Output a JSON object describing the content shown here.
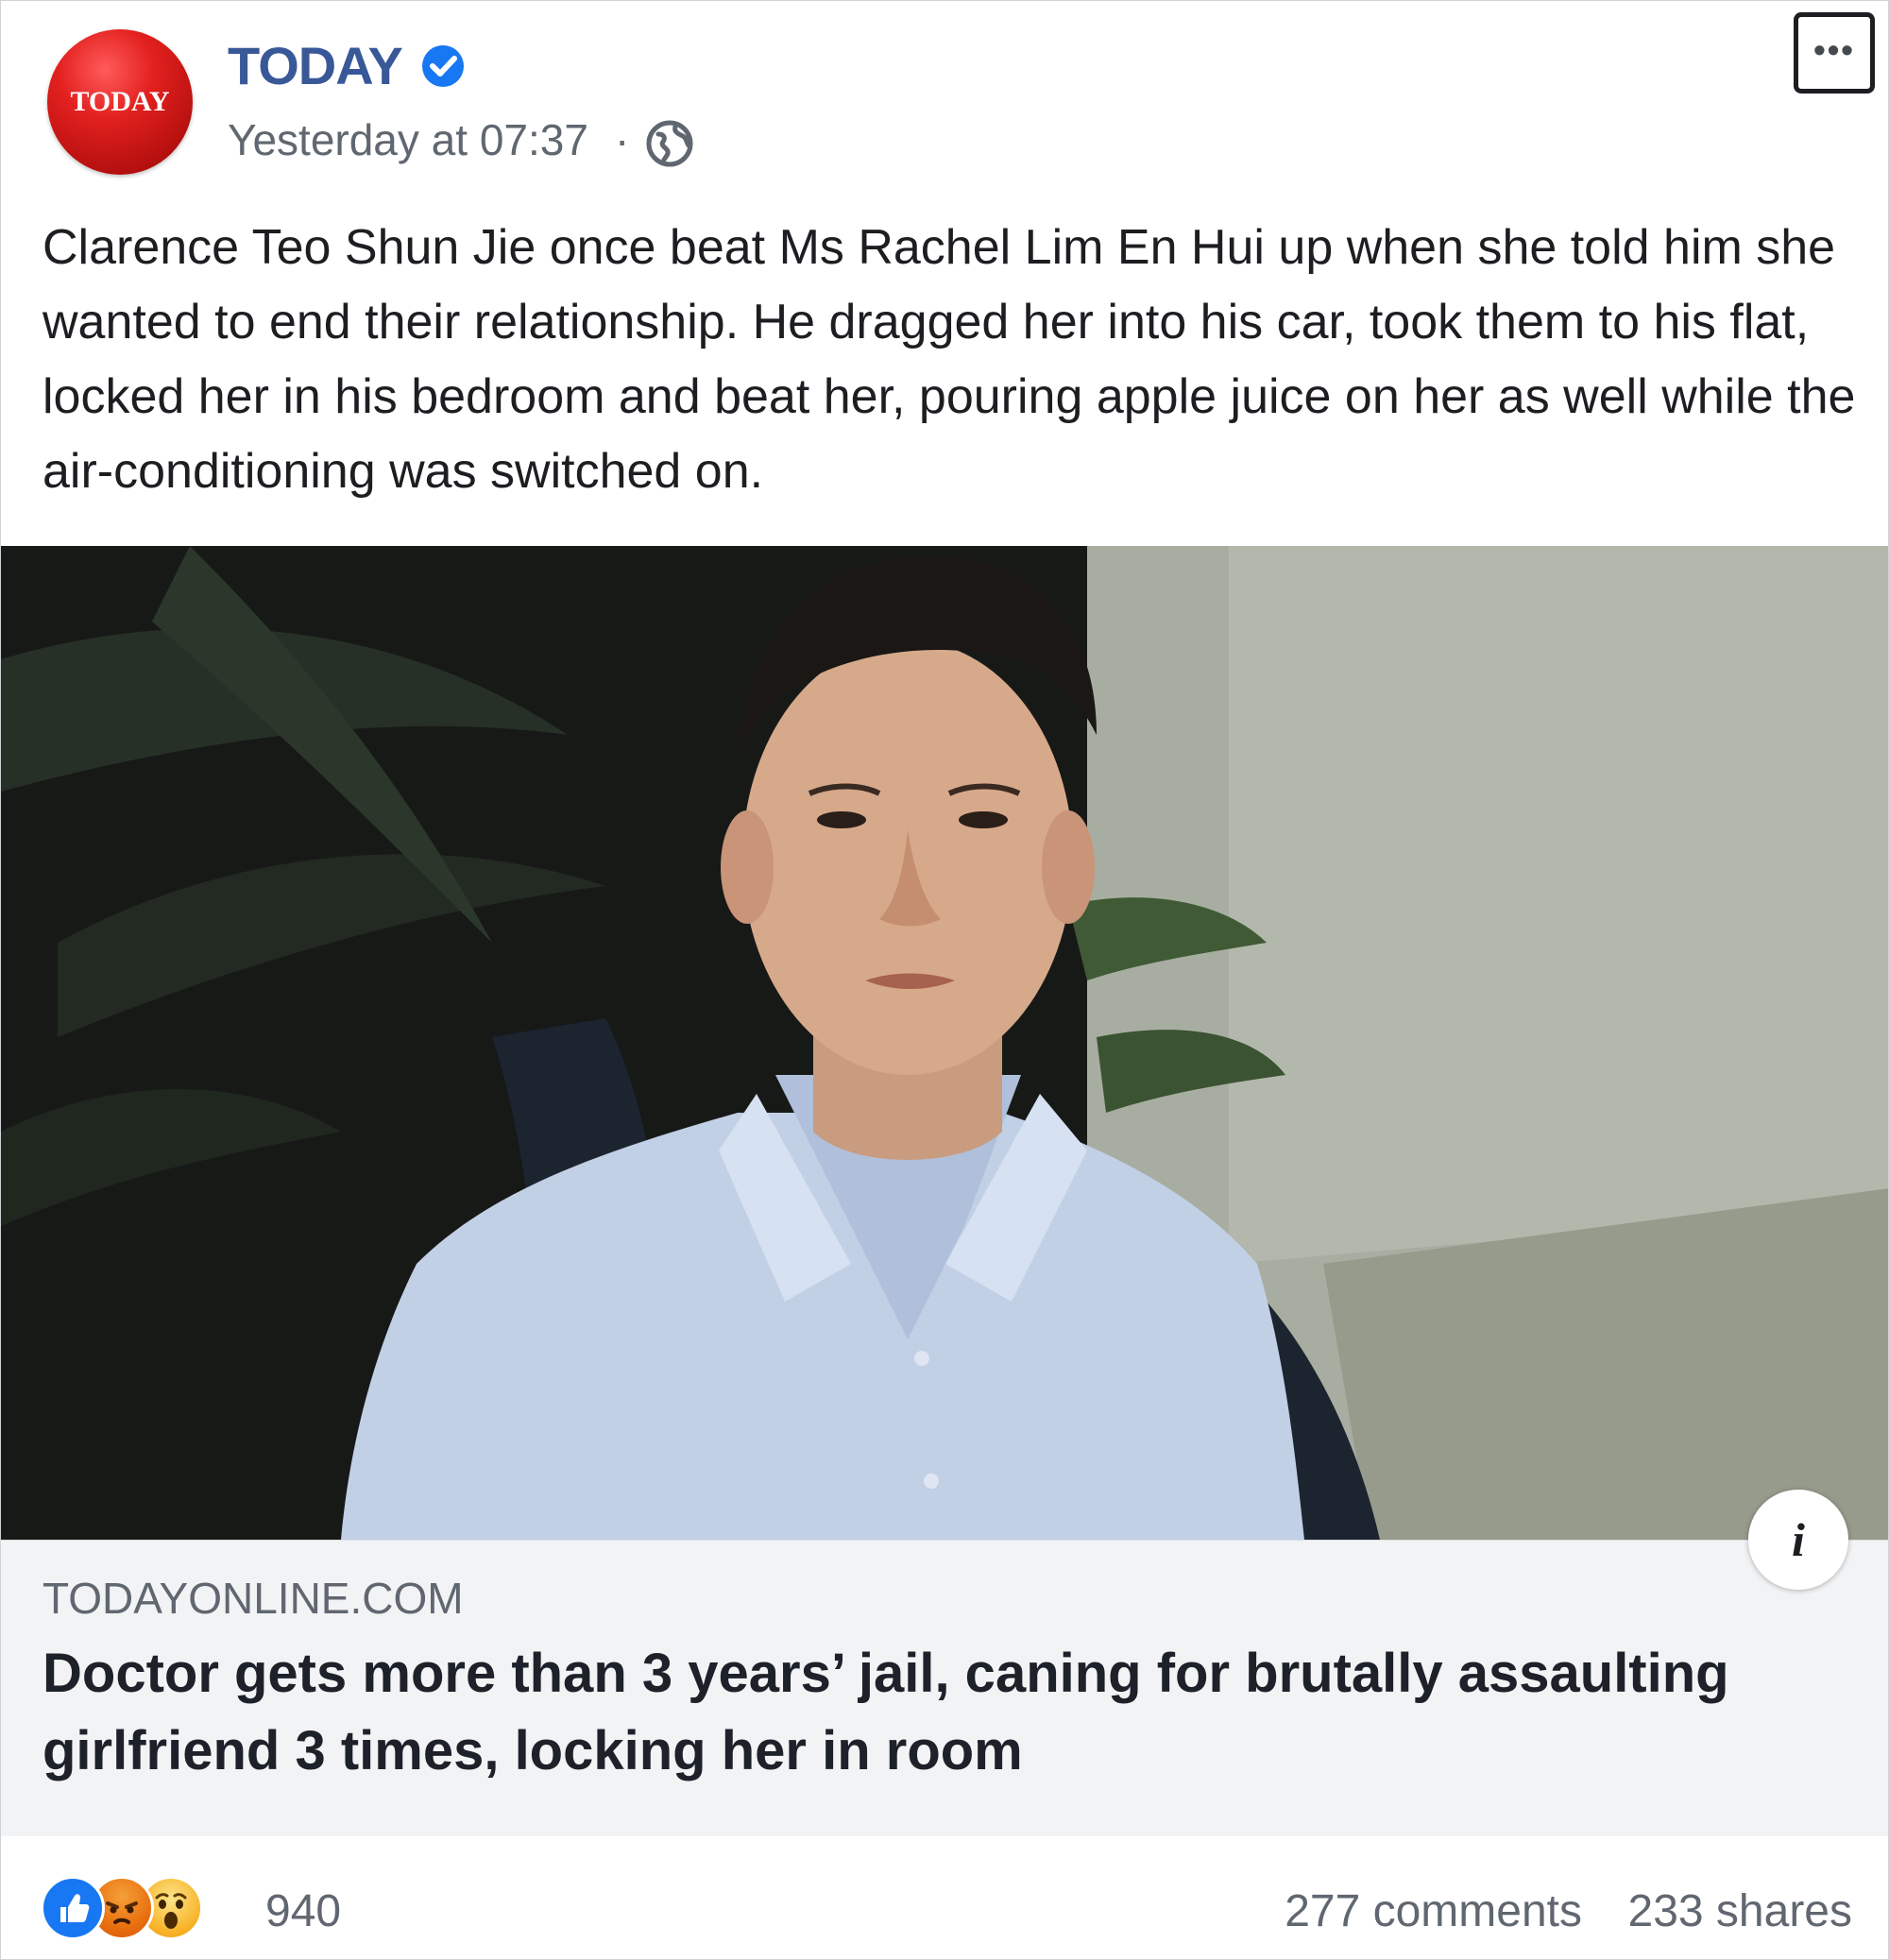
{
  "post": {
    "avatar_text": "TODAY",
    "page_name": "TODAY",
    "verified_icon": "verified-check-icon",
    "timestamp": "Yesterday at 07:37",
    "separator": "·",
    "audience_icon": "globe-icon",
    "more_icon": "•••",
    "caption": "Clarence Teo Shun Jie once beat Ms Rachel Lim En Hui up when she told him she wanted to end their relationship. He dragged her into his car, took them to his flat, locked her in his bedroom and beat her, pouring apple juice on her as well while the air-conditioning was switched on."
  },
  "link_preview": {
    "domain": "TODAYONLINE.COM",
    "headline": "Doctor gets more than 3 years’ jail, caning for brutally assaulting girlfriend 3 times, locking her in room",
    "info_icon": "i"
  },
  "footer": {
    "reaction_icons": [
      "like-icon",
      "angry-icon",
      "wow-icon"
    ],
    "reaction_count": "940",
    "comments": "277 comments",
    "shares": "233 shares"
  },
  "colors": {
    "page_name": "#385898",
    "avatar_red": "#d11a1a",
    "like_blue": "#1877f2",
    "angry_orange": "#e9710f",
    "wow_yellow": "#f7b125",
    "link_box_bg": "#f2f3f5"
  }
}
